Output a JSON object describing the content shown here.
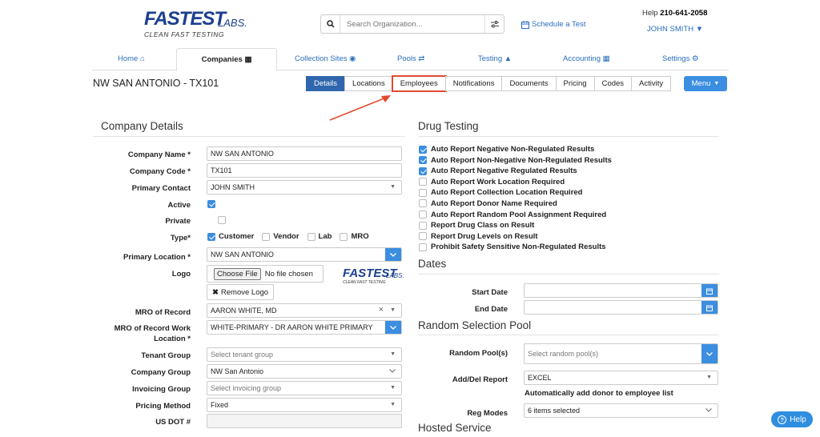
{
  "header": {
    "logo_text": "FASTEST",
    "logo_labs": "LABS.",
    "logo_tag": "CLEAN FAST TESTING",
    "search_placeholder": "Search Organization...",
    "schedule_label": "Schedule a Test",
    "help_prefix": "Help",
    "help_phone": "210-641-2058",
    "user_name": "JOHN SMITH"
  },
  "main_tabs": [
    "Home",
    "Companies",
    "Collection Sites",
    "Pools",
    "Testing",
    "Accounting",
    "Settings"
  ],
  "page_title": "NW SAN ANTONIO - TX101",
  "sub_tabs": [
    "Details",
    "Locations",
    "Employees",
    "Notifications",
    "Documents",
    "Pricing",
    "Codes",
    "Activity"
  ],
  "menu_label": "Menu",
  "company_details": {
    "title": "Company Details",
    "labels": {
      "name": "Company Name *",
      "code": "Company Code *",
      "contact": "Primary Contact",
      "active": "Active",
      "private": "Private",
      "type": "Type*",
      "location": "Primary Location *",
      "logo": "Logo",
      "mro": "MRO of Record",
      "mro_work_1": "MRO of Record Work",
      "mro_work_2": "Location *",
      "tenant": "Tenant Group",
      "company_group": "Company Group",
      "invoicing": "Invoicing Group",
      "pricing": "Pricing Method",
      "usdot": "US DOT #"
    },
    "values": {
      "name": "NW SAN ANTONIO",
      "code": "TX101",
      "contact": "JOHN SMITH",
      "location": "NW SAN ANTONIO",
      "choose_file": "Choose File",
      "no_file": "No file chosen",
      "remove_logo": "Remove Logo",
      "mro": "AARON WHITE, MD",
      "mro_work": "WHITE-PRIMARY - DR AARON WHITE PRIMARY",
      "tenant_ph": "Select tenant group",
      "company_group": "NW San Antonio",
      "invoicing_ph": "Select invoicing group",
      "pricing": "Fixed"
    },
    "types": [
      {
        "label": "Customer",
        "checked": true
      },
      {
        "label": "Vendor",
        "checked": false
      },
      {
        "label": "Lab",
        "checked": false
      },
      {
        "label": "MRO",
        "checked": false
      }
    ]
  },
  "drug_testing": {
    "title": "Drug Testing",
    "options": [
      {
        "label": "Auto Report Negative Non-Regulated Results",
        "checked": true
      },
      {
        "label": "Auto Report Non-Negative Non-Regulated Results",
        "checked": true
      },
      {
        "label": "Auto Report Negative Regulated Results",
        "checked": true
      },
      {
        "label": "Auto Report Work Location Required",
        "checked": false
      },
      {
        "label": "Auto Report Collection Location Required",
        "checked": false
      },
      {
        "label": "Auto Report Donor Name Required",
        "checked": false
      },
      {
        "label": "Auto Report Random Pool Assignment Required",
        "checked": false
      },
      {
        "label": "Report Drug Class on Result",
        "checked": false
      },
      {
        "label": "Report Drug Levels on Result",
        "checked": false
      },
      {
        "label": "Prohibit Safety Sensitive Non-Regulated Results",
        "checked": false
      }
    ]
  },
  "dates": {
    "title": "Dates",
    "start_label": "Start Date",
    "end_label": "End Date"
  },
  "random_pool": {
    "title": "Random Selection Pool",
    "pools_label": "Random Pool(s)",
    "pools_ph": "Select random pool(s)",
    "report_label": "Add/Del Report",
    "report_value": "EXCEL",
    "auto_add": "Automatically add donor to employee list",
    "reg_label": "Reg Modes",
    "reg_value": "6 items selected"
  },
  "hosted": {
    "title": "Hosted Service"
  },
  "help_button": "Help"
}
